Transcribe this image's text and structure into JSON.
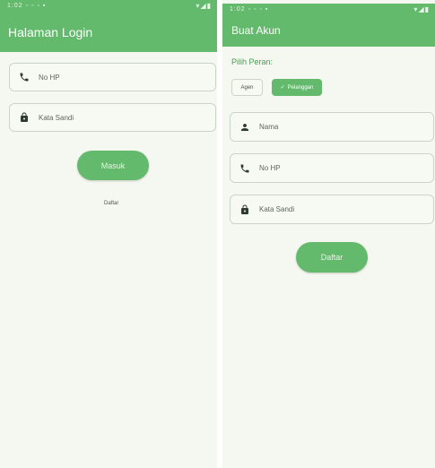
{
  "login": {
    "status_time": "1:02 ◦ ◦ ◦ ▪",
    "status_icons": "▾◢▮",
    "title": "Halaman Login",
    "phone_placeholder": "No HP",
    "password_placeholder": "Kata Sandi",
    "login_button": "Masuk",
    "register_link": "Daftar"
  },
  "register": {
    "status_time": "1:02 ◦ ◦ ◦ ▪",
    "status_icons": "▾◢▮",
    "title": "Buat Akun",
    "role_label": "Pilih Peran:",
    "role_options": [
      "Agen",
      "Pelanggan"
    ],
    "selected_check": "✓",
    "name_placeholder": "Nama",
    "phone_placeholder": "No HP",
    "password_placeholder": "Kata Sandi",
    "register_button": "Daftar"
  },
  "colors": {
    "primary": "#63b96c",
    "background": "#f4f8f0",
    "label": "#4c9a55"
  }
}
